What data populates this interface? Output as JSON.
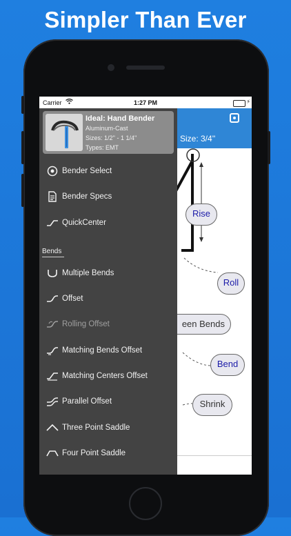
{
  "headline": "Simpler Than Ever",
  "status_bar": {
    "carrier": "Carrier",
    "time": "1:27 PM"
  },
  "app": {
    "size_label": "Size: 3/4''"
  },
  "diagram": {
    "callouts": {
      "rise": "Rise",
      "roll": "Roll",
      "between_bends": "een Bends",
      "bend": "Bend",
      "shrink": "Shrink"
    }
  },
  "drawer": {
    "profile": {
      "title": "Ideal: Hand Bender",
      "material": "Aluminum-Cast",
      "sizes": "Sizes: 1/2'' - 1 1/4''",
      "types": "Types: EMT"
    },
    "top_items": [
      {
        "label": "Bender Select",
        "icon": "target-icon"
      },
      {
        "label": "Bender Specs",
        "icon": "document-icon"
      },
      {
        "label": "QuickCenter",
        "icon": "quickcenter-icon"
      }
    ],
    "section_header": "Bends",
    "bend_items": [
      {
        "label": "Multiple Bends",
        "icon": "u-bend-icon",
        "enabled": true
      },
      {
        "label": "Offset",
        "icon": "offset-icon",
        "enabled": true
      },
      {
        "label": "Rolling Offset",
        "icon": "rolling-offset-icon",
        "enabled": false
      },
      {
        "label": "Matching Bends Offset",
        "icon": "matching-bends-icon",
        "enabled": true
      },
      {
        "label": "Matching Centers Offset",
        "icon": "matching-centers-icon",
        "enabled": true
      },
      {
        "label": "Parallel Offset",
        "icon": "parallel-offset-icon",
        "enabled": true
      },
      {
        "label": "Three Point Saddle",
        "icon": "three-point-saddle-icon",
        "enabled": true
      },
      {
        "label": "Four Point Saddle",
        "icon": "four-point-saddle-icon",
        "enabled": true
      }
    ]
  },
  "colors": {
    "background": "#1f7fe0",
    "app_bar": "#2f86d6",
    "drawer": "#434343",
    "profile_card": "#8c8c8c",
    "callout_text": "#1a1aa8"
  }
}
